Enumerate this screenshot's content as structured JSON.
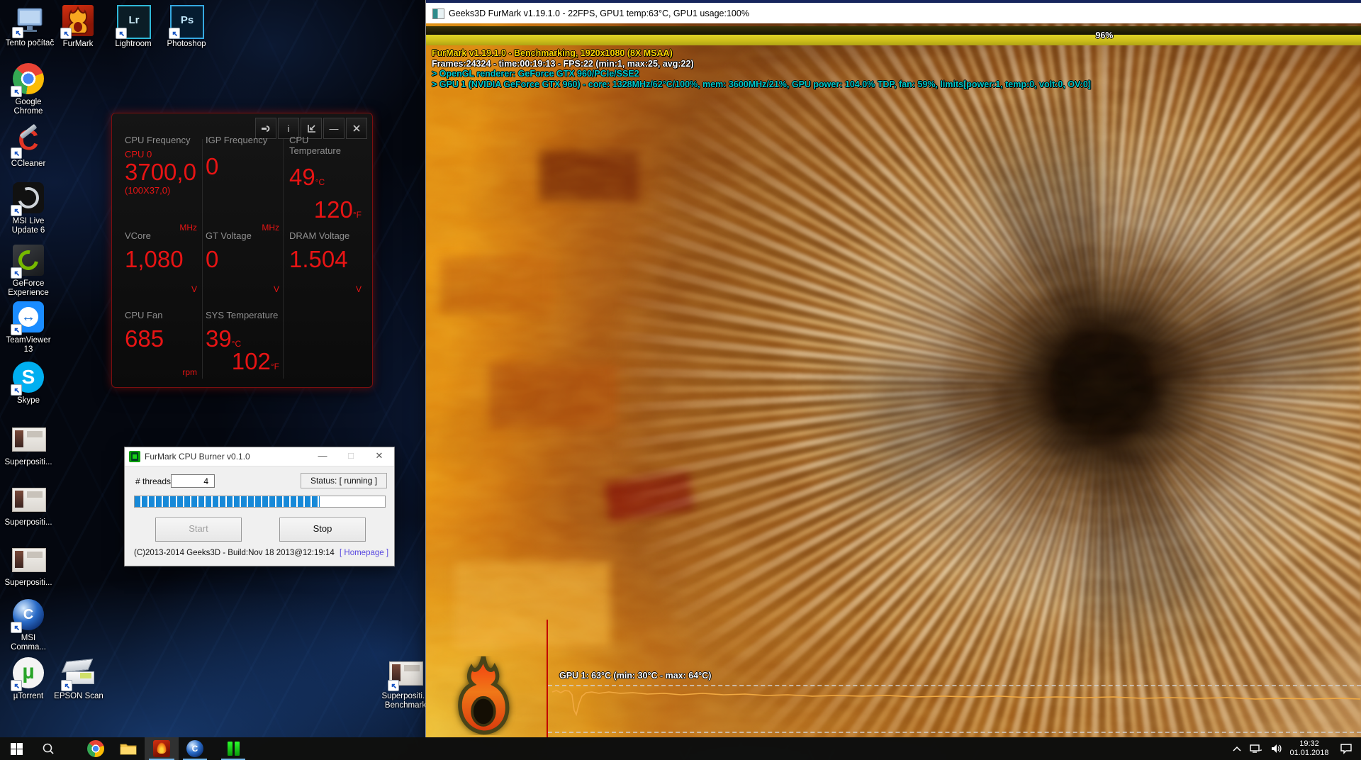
{
  "desktop": {
    "icons": [
      {
        "name": "this-pc",
        "label": "Tento počítač"
      },
      {
        "name": "furmark",
        "label": "FurMark"
      },
      {
        "name": "lightroom",
        "label": "Lightroom"
      },
      {
        "name": "photoshop",
        "label": "Photoshop"
      },
      {
        "name": "google-chrome",
        "label": "Google\nChrome"
      },
      {
        "name": "ccleaner",
        "label": "CCleaner"
      },
      {
        "name": "msi-live-update",
        "label": "MSI Live\nUpdate 6"
      },
      {
        "name": "geforce-experience",
        "label": "GeForce\nExperience"
      },
      {
        "name": "teamviewer",
        "label": "TeamViewer\n13"
      },
      {
        "name": "skype",
        "label": "Skype"
      },
      {
        "name": "superposition-1",
        "label": "Superpositi..."
      },
      {
        "name": "superposition-2",
        "label": "Superpositi..."
      },
      {
        "name": "superposition-3",
        "label": "Superpositi..."
      },
      {
        "name": "msi-command-center",
        "label": "MSI\nComma..."
      },
      {
        "name": "utorrent",
        "label": "µTorrent"
      },
      {
        "name": "epson-scan",
        "label": "EPSON Scan"
      },
      {
        "name": "superposition-benchmark",
        "label": "Superpositi...\nBenchmark"
      }
    ],
    "icon_glyphs": {
      "lr": "Lr",
      "ps": "Ps",
      "ccleaner": "C",
      "skype": "S",
      "msi_command": "C",
      "utorrent": "µ",
      "teamviewer": "↔"
    }
  },
  "hw_monitor": {
    "cells": [
      {
        "label": "CPU Frequency",
        "sub": "CPU 0",
        "value": "3700,0",
        "extra": "(100X37,0)",
        "unit": "MHz"
      },
      {
        "label": "IGP Frequency",
        "value": "0",
        "unit": "MHz"
      },
      {
        "label": "CPU Temperature",
        "value": "49",
        "value_unit": "°C",
        "value2": "120",
        "value2_unit": "°F"
      },
      {
        "label": "VCore",
        "value": "1,080",
        "unit": "V"
      },
      {
        "label": "GT Voltage",
        "value": "0",
        "unit": "V"
      },
      {
        "label": "DRAM Voltage",
        "value": "1.504",
        "unit": "V"
      },
      {
        "label": "CPU Fan",
        "value": "685",
        "unit": "rpm"
      },
      {
        "label": "SYS Temperature",
        "value": "39",
        "value_unit": "°C",
        "value2": "102",
        "value2_unit": "°F"
      }
    ],
    "info_glyph": "i",
    "minimize_glyph": "—",
    "accent_color": "#e81414",
    "label_color": "#8f8f8f"
  },
  "cpu_burner": {
    "title": "FurMark CPU Burner v0.1.0",
    "minimize_glyph": "—",
    "maximize_glyph": "□",
    "close_glyph": "✕",
    "threads_label": "# threads",
    "threads_value": "4",
    "status": "Status: [ running ]",
    "start_label": "Start",
    "stop_label": "Stop",
    "progress_percent": 74,
    "footer": "(C)2013-2014 Geeks3D - Build:Nov 18 2013@12:19:14",
    "homepage_label": "[ Homepage ]"
  },
  "furmark": {
    "window_title": "Geeks3D FurMark v1.19.1.0 - 22FPS, GPU1 temp:63°C, GPU1 usage:100%",
    "progress_label": "96%",
    "progress_bar_color": "#cdbf1a",
    "osd": [
      {
        "text": "FurMark v1.19.1.0 - Benchmarking, 1920x1080 (8X MSAA)",
        "color": "#ffd800"
      },
      {
        "text": "Frames:24324 - time:00:19:13 - FPS:22 (min:1, max:25, avg:22)",
        "color": "#ffffff"
      },
      {
        "text": "> OpenGL renderer: GeForce GTX 960/PCIe/SSE2",
        "color": "#00c8c8"
      },
      {
        "text": "> GPU 1 (NVIDIA GeForce GTX 960) - core: 1328MHz/62°C/100%, mem: 3600MHz/21%, GPU power: 104.0% TDP, fan: 59%, limits[power:1, temp:0, volt:0, OV:0]",
        "color": "#00c8c8"
      }
    ],
    "graph_label": "GPU 1: 63°C (min: 30°C - max: 64°C)",
    "graph_line_color": "#f2aa42"
  },
  "taskbar": {
    "time": "19:32",
    "date": "01.01.2018"
  }
}
